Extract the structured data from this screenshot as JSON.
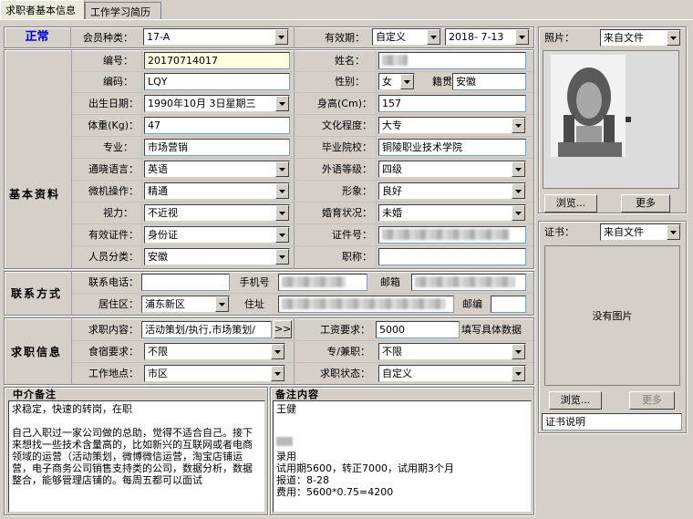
{
  "tabs": [
    {
      "label": "求职者基本信息"
    },
    {
      "label": "工作学习简历"
    }
  ],
  "status": {
    "label": "正常",
    "color": "#0000cc"
  },
  "member_type": {
    "label": "会员种类：",
    "value": "17-A"
  },
  "validity": {
    "label": "有效期：",
    "mode": "自定义",
    "date": "2018- 7-13"
  },
  "sections": {
    "basic": "基本资料",
    "contact": "联系方式",
    "jobinfo": "求职信息",
    "agency_notes": "中介备注",
    "remarks": "备注内容"
  },
  "basic": {
    "number_label": "编号：",
    "number": "20170714017",
    "name_label": "姓名：",
    "code_label": "编码：",
    "code": "LQY",
    "gender_label": "性别：",
    "gender": "女",
    "native_label": "籍贯",
    "native": "安徽",
    "birth_label": "出生日期：",
    "birth": "1990年10月 3日星期三",
    "height_label": "身高(Cm)：",
    "height": "157",
    "weight_label": "体重(Kg)：",
    "weight": "47",
    "edu_label": "文化程度：",
    "edu": "大专",
    "major_label": "专业：",
    "major": "市场营销",
    "school_label": "毕业院校：",
    "school": "铜陵职业技术学院",
    "lang_label": "通晓语言：",
    "lang": "英语",
    "foreign_label": "外语等级：",
    "foreign": "四级",
    "pc_label": "微机操作：",
    "pc": "精通",
    "image_label": "形象：",
    "image": "良好",
    "vision_label": "视力：",
    "vision": "不近视",
    "marital_label": "婚育状况：",
    "marital": "未婚",
    "idtype_label": "有效证件：",
    "idtype": "身份证",
    "idno_label": "证件号：",
    "category_label": "人员分类：",
    "category": "安徽",
    "title_label": "职称：",
    "title": ""
  },
  "contact": {
    "phone_label": "联系电话：",
    "phone": "",
    "mobile_label": "手机号",
    "email_label": "邮箱",
    "district_label": "居住区：",
    "district": "浦东新区",
    "address_label": "住址",
    "zip_label": "邮编",
    "zip": ""
  },
  "job": {
    "content_label": "求职内容：",
    "content": "活动策划/执行,市场策划/",
    "more_btn": ">>",
    "salary_label": "工资要求：",
    "salary": "5000",
    "salary_hint": "填写具体数据",
    "board_label": "食宿要求：",
    "board": "不限",
    "parttime_label": "专/兼职：",
    "parttime": "不限",
    "place_label": "工作地点：",
    "place": "市区",
    "status_label": "求职状态：",
    "status": "自定义"
  },
  "agency_text": "求稳定，快速的转岗，在职\n\n自己入职过一家公司做的总助，觉得不适合自己。接下来想找一些技术含量高的，比如新兴的互联网或者电商领域的运营（活动策划，微博微信运营，淘宝店铺运营，电子商务公司销售支持类的公司，数据分析，数据整合，能够管理店铺的。每周五都可以面试",
  "remarks_text": "王健\n\n\n\n录用\n试用期5600，转正7000，试用期3个月\n报道：8-28\n费用：5600*0.75=4200",
  "photo": {
    "label": "照片：",
    "source": "来自文件",
    "browse": "浏览...",
    "more": "更多"
  },
  "cert": {
    "label": "证书：",
    "source": "来自文件",
    "no_image": "没有图片",
    "browse": "浏览...",
    "more": "更多",
    "desc": "证书说明"
  }
}
